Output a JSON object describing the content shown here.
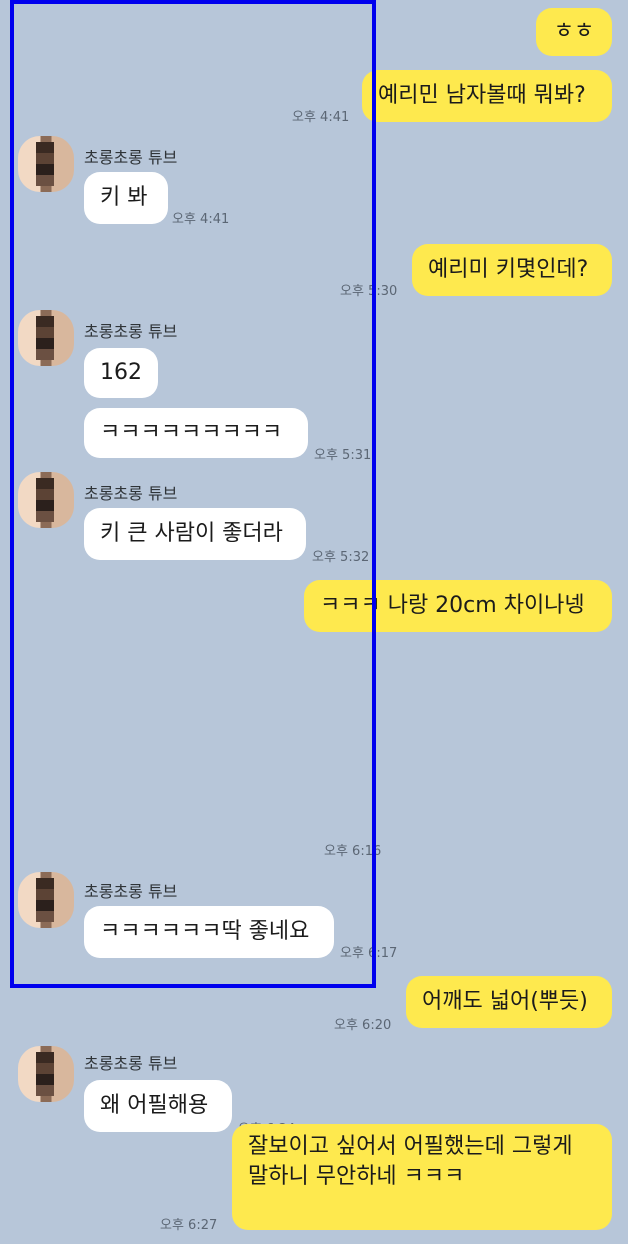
{
  "colors": {
    "background": "#b7c6d9",
    "my_bubble": "#fee94e",
    "their_bubble": "#ffffff",
    "selection_box": "#0000ee"
  },
  "contact": {
    "name": "초롱초롱 튜브",
    "avatar": "pixelated-avatar"
  },
  "messages": [
    {
      "text": "ㅎㅎ",
      "time": ""
    },
    {
      "text": "예리민 남자볼때 뭐봐?",
      "time": "오후 4:41"
    },
    {
      "sender": "초롱초롱 튜브",
      "text": "키 봐",
      "time": "오후 4:41"
    },
    {
      "text": "예리미 키몇인데?",
      "time": "오후 5:30"
    },
    {
      "sender": "초롱초롱 튜브",
      "text": "162",
      "time": ""
    },
    {
      "text": "ㅋㅋㅋㅋㅋㅋㅋㅋㅋ",
      "time": "오후 5:31"
    },
    {
      "sender": "초롱초롱 튜브",
      "text": "키 큰 사람이 좋더라",
      "time": "오후 5:32"
    },
    {
      "text": "ㅋㅋㅋ 나랑 20cm 차이나넹",
      "time": ""
    },
    {
      "time": "오후 6:16"
    },
    {
      "sender": "초롱초롱 튜브",
      "text": "ㅋㅋㅋㅋㅋㅋ딱 좋네요",
      "time": "오후 6:17"
    },
    {
      "text": "어깨도 넓어(뿌듯)",
      "time": "오후 6:20"
    },
    {
      "sender": "초롱초롱 튜브",
      "text": "왜 어필해용",
      "time": "오후 6:24"
    },
    {
      "text": "잘보이고 싶어서 어필했는데 그렇게 말하니 무안하네 ㅋㅋㅋ",
      "time": "오후 6:27"
    }
  ]
}
